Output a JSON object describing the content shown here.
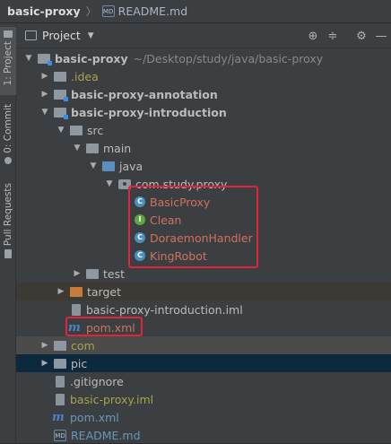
{
  "breadcrumb": {
    "project": "basic-proxy",
    "file": "README.md",
    "file_icon_text": "MD"
  },
  "left_tabs": [
    {
      "label": "1: Project",
      "active": true
    },
    {
      "label": "0: Commit",
      "active": false
    },
    {
      "label": "Pull Requests",
      "active": false
    }
  ],
  "panel": {
    "title": "Project",
    "toolbar_icons": [
      "crosshair-icon",
      "collapse-all-icon",
      "gear-icon",
      "minimize-icon"
    ]
  },
  "tree": [
    {
      "depth": 0,
      "arrow": "down",
      "icon": "folder-module",
      "label": "basic-proxy",
      "bold": true,
      "path": "~/Desktop/study/java/basic-proxy",
      "color": "def"
    },
    {
      "depth": 1,
      "arrow": "right",
      "icon": "folder",
      "label": ".idea",
      "color": "olive"
    },
    {
      "depth": 1,
      "arrow": "right",
      "icon": "folder-module",
      "label": "basic-proxy-annotation",
      "bold": true,
      "color": "def"
    },
    {
      "depth": 1,
      "arrow": "down",
      "icon": "folder-module",
      "label": "basic-proxy-introduction",
      "bold": true,
      "color": "def"
    },
    {
      "depth": 2,
      "arrow": "down",
      "icon": "folder",
      "label": "src",
      "color": "def"
    },
    {
      "depth": 3,
      "arrow": "down",
      "icon": "folder",
      "label": "main",
      "color": "def"
    },
    {
      "depth": 4,
      "arrow": "down",
      "icon": "folder-blue",
      "label": "java",
      "color": "def"
    },
    {
      "depth": 5,
      "arrow": "down",
      "icon": "package",
      "label": "com.study.proxy",
      "color": "def"
    },
    {
      "depth": 6,
      "arrow": "none",
      "icon": "class",
      "glyph": "C",
      "label": "BasicProxy",
      "color": "red"
    },
    {
      "depth": 6,
      "arrow": "none",
      "icon": "interface",
      "glyph": "I",
      "label": "Clean",
      "color": "red"
    },
    {
      "depth": 6,
      "arrow": "none",
      "icon": "class",
      "glyph": "C",
      "label": "DoraemonHandler",
      "color": "red"
    },
    {
      "depth": 6,
      "arrow": "none",
      "icon": "class",
      "glyph": "C",
      "label": "KingRobot",
      "color": "red"
    },
    {
      "depth": 3,
      "arrow": "right",
      "icon": "folder",
      "label": "test",
      "color": "def"
    },
    {
      "depth": 2,
      "arrow": "right",
      "icon": "folder-orange",
      "label": "target",
      "color": "def",
      "state": "hl"
    },
    {
      "depth": 2,
      "arrow": "none",
      "icon": "file",
      "label": "basic-proxy-introduction.iml",
      "color": "def"
    },
    {
      "depth": 2,
      "arrow": "none",
      "icon": "maven",
      "glyph": "m",
      "label": "pom.xml",
      "color": "red"
    },
    {
      "depth": 1,
      "arrow": "right",
      "icon": "folder",
      "label": "com",
      "color": "olive",
      "state": "sel-inactive"
    },
    {
      "depth": 1,
      "arrow": "right",
      "icon": "folder",
      "label": "pic",
      "color": "def",
      "state": "sel-active"
    },
    {
      "depth": 1,
      "arrow": "none",
      "icon": "file",
      "label": ".gitignore",
      "color": "def"
    },
    {
      "depth": 1,
      "arrow": "none",
      "icon": "file",
      "label": "basic-proxy.iml",
      "color": "olive"
    },
    {
      "depth": 1,
      "arrow": "none",
      "icon": "maven",
      "glyph": "m",
      "label": "pom.xml",
      "color": "blue"
    },
    {
      "depth": 1,
      "arrow": "none",
      "icon": "md",
      "glyph": "MD",
      "label": "README.md",
      "color": "blue"
    }
  ],
  "colors": {
    "highlight_box": "#e0243a",
    "error_text": "#d2705c",
    "excluded_text": "#a8a34a",
    "modified_text": "#6897bb"
  }
}
